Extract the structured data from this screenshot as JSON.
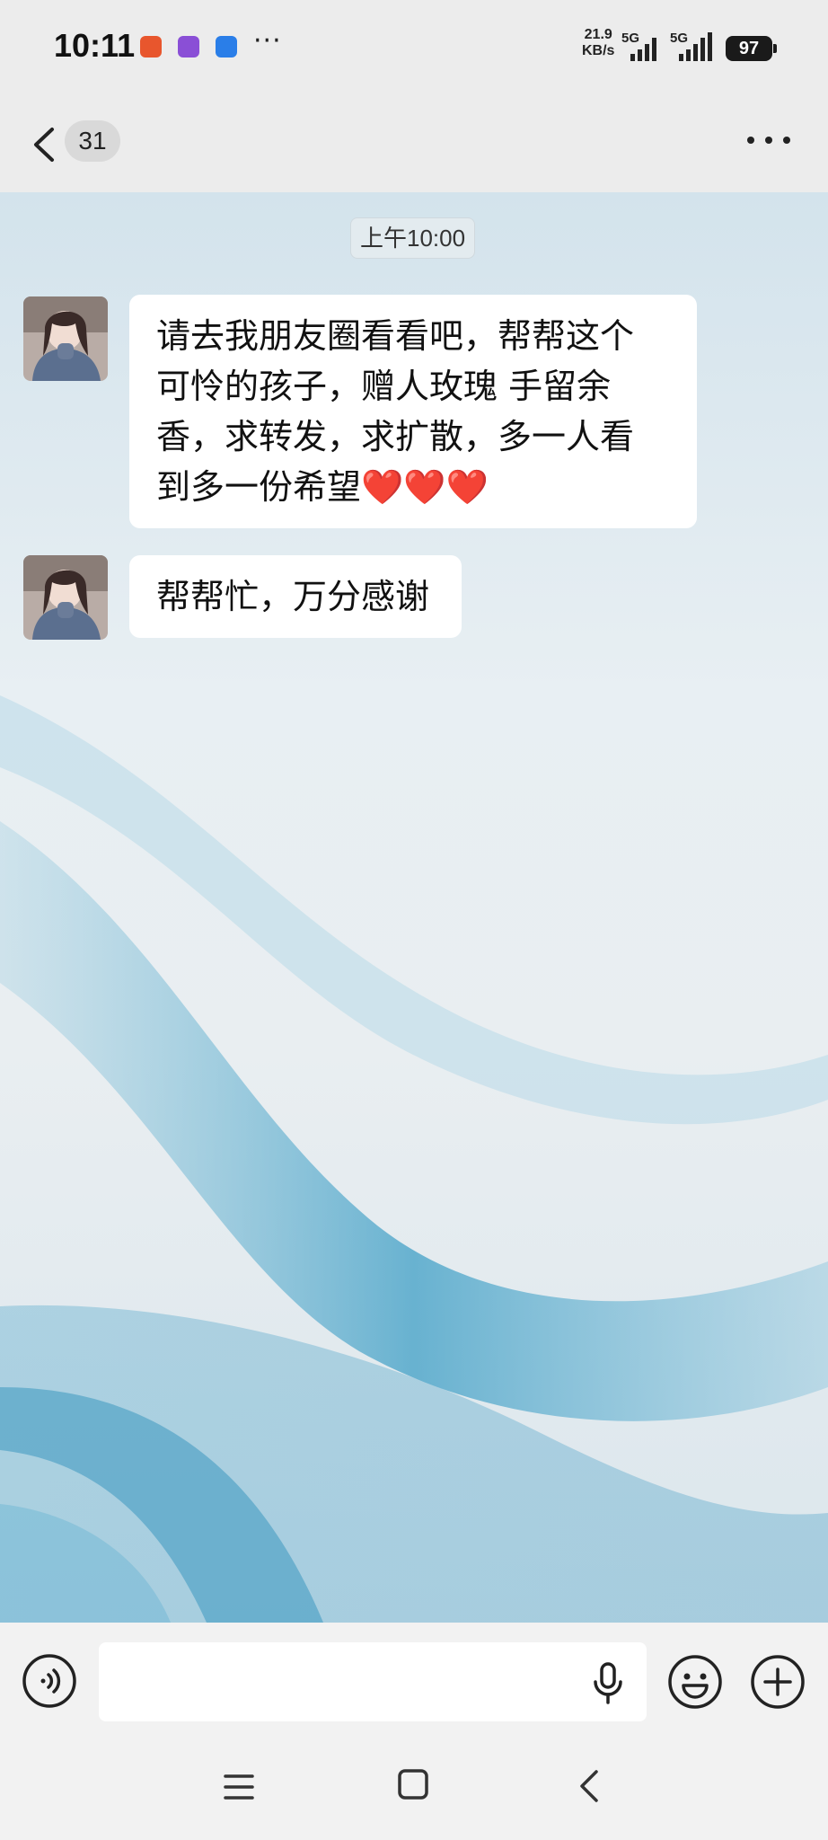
{
  "status_bar": {
    "time": "10:11",
    "more": "···",
    "net_speed_value": "21.9",
    "net_speed_unit": "KB/s",
    "signal1_label": "5G",
    "signal2_label": "5G",
    "battery": "97",
    "app_icons": [
      "app-notification-icon",
      "app-purple-icon",
      "app-blue-icon"
    ],
    "app_icon_colors": [
      "#e8562d",
      "#8a4fd6",
      "#2a7ee8"
    ]
  },
  "header": {
    "unread_count": "31",
    "back_icon": "chevron-left-icon",
    "more_icon": "more-horizontal-icon"
  },
  "chat": {
    "time_divider": "上午10:00",
    "messages": [
      {
        "sender": "incoming",
        "lines": [
          "请去我朋友圈看看吧，帮帮这个",
          "可怜的孩子，赠人玫瑰 手留余",
          "香，求转发，求扩散，多一人看",
          "到多一份希望"
        ],
        "hearts": "❤️❤️❤️"
      },
      {
        "sender": "incoming",
        "lines": [
          "帮帮忙，万分感谢"
        ]
      }
    ]
  },
  "input_bar": {
    "placeholder": "",
    "voice_icon": "voice-icon",
    "mic_icon": "microphone-icon",
    "emoji_icon": "emoji-icon",
    "add_icon": "plus-circle-icon"
  },
  "nav_bar": {
    "icons": [
      "menu-icon",
      "home-square-icon",
      "back-chevron-icon"
    ]
  },
  "colors": {
    "bubble_bg": "#ffffff",
    "heart": "#e0182d",
    "wave": "#4aa3c8"
  }
}
